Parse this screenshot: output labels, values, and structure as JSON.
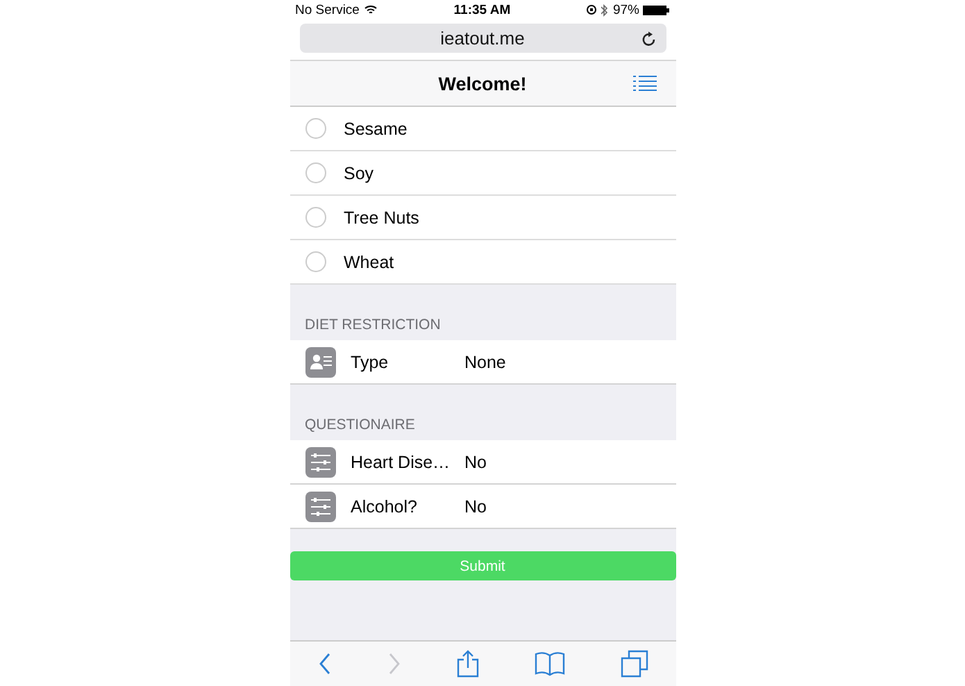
{
  "status_bar": {
    "carrier": "No Service",
    "time": "11:35 AM",
    "battery": "97%"
  },
  "url_bar": {
    "url": "ieatout.me"
  },
  "nav_bar": {
    "title": "Welcome!"
  },
  "allergies": [
    {
      "label": "Sesame",
      "selected": false
    },
    {
      "label": "Soy",
      "selected": false
    },
    {
      "label": "Tree Nuts",
      "selected": false
    },
    {
      "label": "Wheat",
      "selected": false
    }
  ],
  "sections": [
    {
      "header": "DIET RESTRICTION",
      "rows": [
        {
          "kind": "profile",
          "label": "Type",
          "value": "None"
        }
      ]
    },
    {
      "header": "QUESTIONAIRE",
      "rows": [
        {
          "kind": "sliders",
          "label": "Heart Dise…",
          "value": "No"
        },
        {
          "kind": "sliders",
          "label": "Alcohol?",
          "value": "No"
        }
      ]
    }
  ],
  "submit": {
    "label": "Submit"
  },
  "toolbar": {
    "back_disabled": false,
    "forward_disabled": true
  }
}
